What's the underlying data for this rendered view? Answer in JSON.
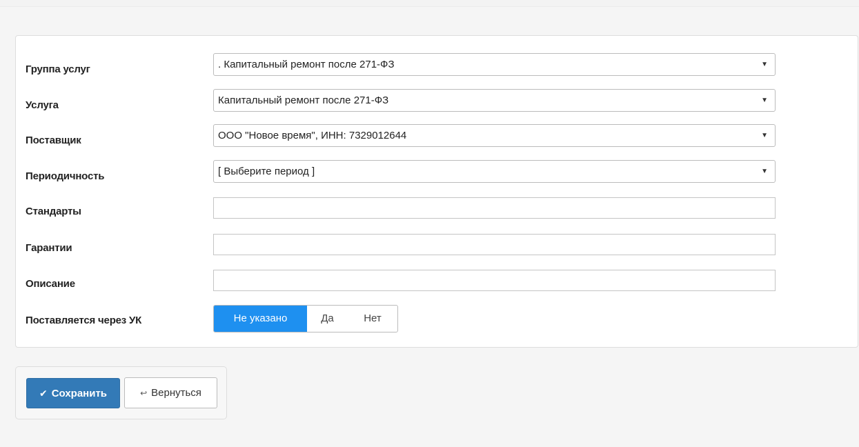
{
  "form": {
    "fields": [
      {
        "label": "Группа услуг",
        "type": "select",
        "value": ". Капитальный ремонт после 271-ФЗ"
      },
      {
        "label": "Услуга",
        "type": "select",
        "value": "Капитальный ремонт после 271-ФЗ"
      },
      {
        "label": "Поставщик",
        "type": "select",
        "value": "ООО \"Новое время\", ИНН: 7329012644"
      },
      {
        "label": "Периодичность",
        "type": "select",
        "value": "[ Выберите период ]"
      },
      {
        "label": "Стандарты",
        "type": "text",
        "value": ""
      },
      {
        "label": "Гарантии",
        "type": "text",
        "value": ""
      },
      {
        "label": "Описание",
        "type": "text",
        "value": ""
      }
    ],
    "via_uk": {
      "label": "Поставляется через УК",
      "options": [
        "Не указано",
        "Да",
        "Нет"
      ],
      "selected": "Не указано"
    }
  },
  "actions": {
    "save_label": "Сохранить",
    "back_label": "Вернуться"
  },
  "icons": {
    "save": "check-icon",
    "back": "back-arrow-icon",
    "dropdown": "chevron-down-icon"
  },
  "colors": {
    "primary": "#337ab7",
    "segment_active": "#1e90f0"
  }
}
